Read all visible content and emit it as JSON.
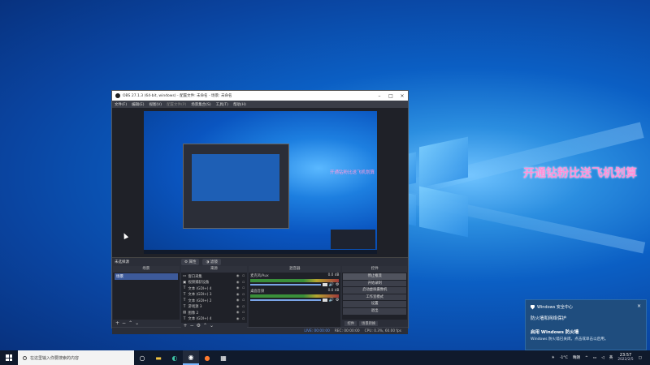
{
  "desktop": {
    "overlay_text": "开通钻粉比送飞机划算"
  },
  "obs": {
    "title": "OBS 27.1.3 (64-bit, windows) - 配置文件: 未命名 - 场景: 未命名",
    "menu": [
      "文件(F)",
      "编辑(E)",
      "视图(V)",
      "配置文件(P)",
      "场景集合(S)",
      "工具(T)",
      "帮助(H)"
    ],
    "preview_overlay_text": "开通钻粉比送飞机划算",
    "scene_bar": {
      "label": "未选择源",
      "properties": "属性",
      "filters": "滤镜"
    },
    "docks": {
      "scenes": {
        "header": "场景",
        "items": [
          "场景"
        ]
      },
      "sources": {
        "header": "来源",
        "items": [
          {
            "icon": "window",
            "name": "窗口采集"
          },
          {
            "icon": "camera",
            "name": "视频捕获设备"
          },
          {
            "icon": "text",
            "name": "文本 (GDI+) 4"
          },
          {
            "icon": "text",
            "name": "文本 (GDI+) 3"
          },
          {
            "icon": "text",
            "name": "文本 (GDI+) 2"
          },
          {
            "icon": "text",
            "name": "游戏源 3"
          },
          {
            "icon": "image",
            "name": "图像 2"
          },
          {
            "icon": "text",
            "name": "文本 (GDI+) 4"
          }
        ]
      },
      "mixer": {
        "header": "混音器",
        "channels": [
          {
            "name": "麦克风/Aux",
            "level": "0.0 dB"
          },
          {
            "name": "桌面音频",
            "level": "0.0 dB"
          }
        ]
      },
      "controls": {
        "header": "控件",
        "buttons": [
          "停止推流",
          "开始录制",
          "启动虚拟摄像机",
          "工作室模式",
          "设置",
          "退出"
        ]
      }
    },
    "bottom_tabs": [
      "控件",
      "场景转换"
    ],
    "status": {
      "live": "LIVE: 00:00:00",
      "rec": "REC: 00:00:00",
      "cpu": "CPU: 0.3%, 60.00 fps"
    }
  },
  "notification": {
    "app": "Windows 安全中心",
    "title": "防火墙和网络保护",
    "subtitle": "启用 Windows 防火墙",
    "body": "Windows 防火墙已关闭。点击或单击以启用。"
  },
  "taskbar": {
    "search_placeholder": "在这里输入你要搜索的内容",
    "weather": "-1°C",
    "tray_label": "晴朗",
    "ime": "英",
    "time": "23:57",
    "date": "2022/2/5"
  }
}
